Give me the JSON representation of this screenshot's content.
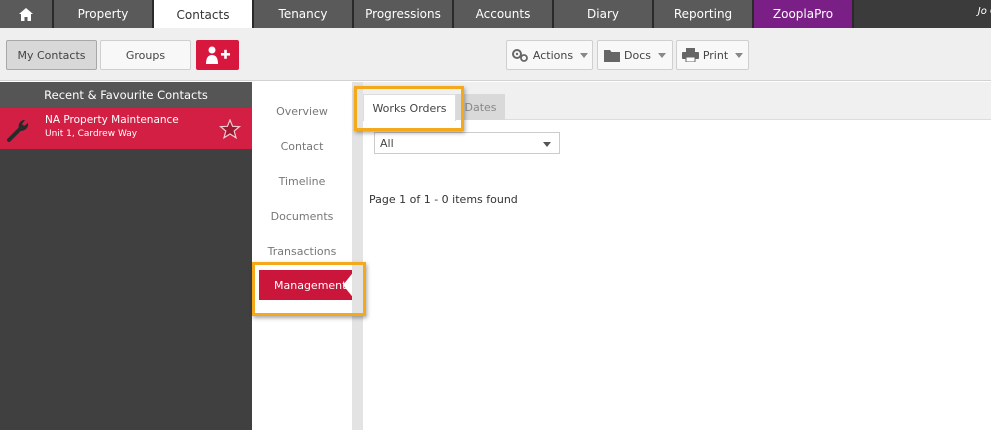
{
  "nav": {
    "tabs": [
      {
        "label": "Property"
      },
      {
        "label": "Contacts"
      },
      {
        "label": "Tenancy"
      },
      {
        "label": "Progressions"
      },
      {
        "label": "Accounts"
      },
      {
        "label": "Diary"
      },
      {
        "label": "Reporting"
      },
      {
        "label": "ZooplaPro"
      }
    ],
    "active_tab": "Contacts",
    "user": "Jo C"
  },
  "toolbar": {
    "my_contacts": "My Contacts",
    "groups": "Groups",
    "add_contact_icon": "user-plus-icon",
    "actions": "Actions",
    "docs": "Docs",
    "print": "Print"
  },
  "left_panel": {
    "header": "Recent & Favourite Contacts",
    "contacts": [
      {
        "name": "NA Property Maintenance",
        "address": "Unit 1, Cardrew Way",
        "icon": "wrench-icon",
        "favourite": true
      }
    ]
  },
  "side_menu": {
    "items": [
      {
        "label": "Overview"
      },
      {
        "label": "Contact"
      },
      {
        "label": "Timeline"
      },
      {
        "label": "Documents"
      },
      {
        "label": "Transactions"
      },
      {
        "label": "Management"
      }
    ],
    "active": "Management"
  },
  "main": {
    "tabs": [
      {
        "label": "Works Orders"
      },
      {
        "label": "Dates"
      }
    ],
    "active_tab": "Works Orders",
    "filter_value": "All",
    "pager_text": "Page 1 of 1 - 0 items found"
  },
  "colors": {
    "brand_red": "#d31f43",
    "highlight": "#f4a81c",
    "zoopla_purple": "#7a1f86",
    "nav_bg": "#5a5a5a"
  }
}
